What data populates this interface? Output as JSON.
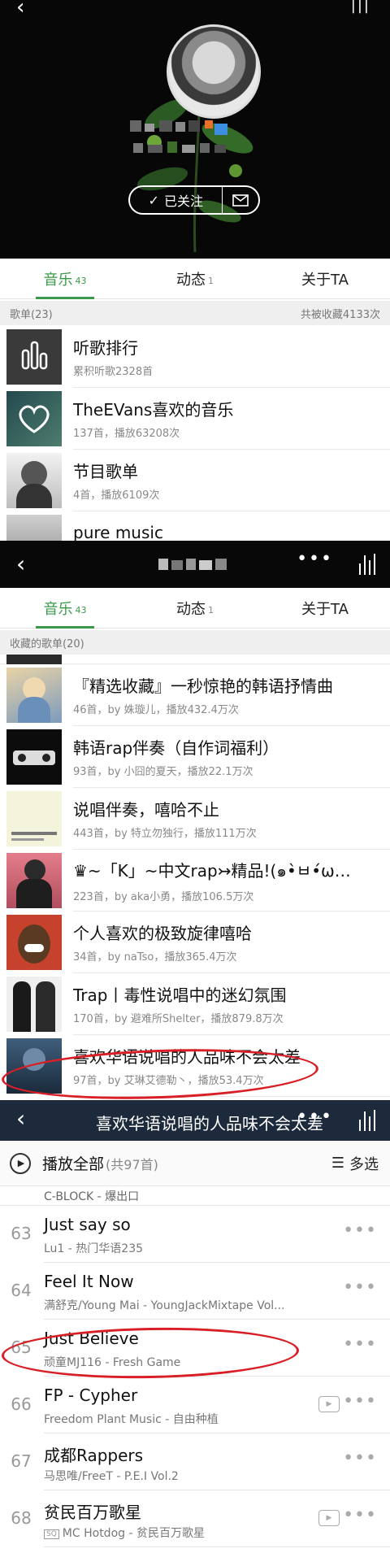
{
  "tabs": [
    {
      "label": "音乐",
      "count": "43"
    },
    {
      "label": "动态",
      "count": "1"
    },
    {
      "label": "关于TA",
      "count": ""
    }
  ],
  "profile": {
    "follow_label": "已关注"
  },
  "playlists_section": {
    "header_left": "歌单(23)",
    "header_right": "共被收藏4133次",
    "items": [
      {
        "title": "听歌排行",
        "sub": "累积听歌2328首"
      },
      {
        "title": "TheEVans喜欢的音乐",
        "sub": "137首，播放63208次"
      },
      {
        "title": "节目歌单",
        "sub": "4首，播放6109次"
      },
      {
        "title": "pure music",
        "sub": ""
      }
    ]
  },
  "collected_section": {
    "header": "收藏的歌单(20)",
    "items": [
      {
        "title": "『精选收藏』一秒惊艳的韩语抒情曲",
        "sub": "46首，by 姝璇儿，播放432.4万次"
      },
      {
        "title": "韩语rap伴奏（自作词福利）",
        "sub": "93首，by 小囧的夏天，播放22.1万次"
      },
      {
        "title": "说唱伴奏，嘻哈不止",
        "sub": "443首，by 特立勿独行，播放111万次"
      },
      {
        "title": "♛~「K」~中文rap↣精品!(๑•̀ㅂ•́ω…",
        "sub": "223首，by aka小勇，播放106.5万次"
      },
      {
        "title": "个人喜欢的极致旋律嘻哈",
        "sub": "34首，by naTso，播放365.4万次"
      },
      {
        "title": "Trap丨毒性说唱中的迷幻氛围",
        "sub": "170首，by 避难所Shelter，播放879.8万次"
      },
      {
        "title": "喜欢华语说唱的人品味不会太差",
        "sub": "97首，by 艾琳艾德勒丶，播放53.4万次"
      }
    ]
  },
  "songlist_section": {
    "title": "喜欢华语说唱的人品味不会太差",
    "play_all": "播放全部",
    "total": "(共97首)",
    "multi_select": "多选",
    "partial_row": "C-BLOCK - 爆出口",
    "songs": [
      {
        "num": "63",
        "name": "Just say so",
        "artist": "Lu1 - 热门华语235",
        "mv": false,
        "sq": false
      },
      {
        "num": "64",
        "name": "Feel It Now",
        "artist": "满舒克/Young Mai - YoungJackMixtape Vol...",
        "mv": false,
        "sq": false
      },
      {
        "num": "65",
        "name": "Just Believe",
        "artist": "顽童MJ116 - Fresh Game",
        "mv": false,
        "sq": false
      },
      {
        "num": "66",
        "name": "FP - Cypher",
        "artist": "Freedom Plant Music - 自由种植",
        "mv": true,
        "sq": false
      },
      {
        "num": "67",
        "name": "成都Rappers",
        "artist": "马思唯/FreeT - P.E.I Vol.2",
        "mv": false,
        "sq": false
      },
      {
        "num": "68",
        "name": "贫民百万歌星",
        "artist": "MC Hotdog - 贫民百万歌星",
        "mv": true,
        "sq": true
      }
    ]
  },
  "colors": {
    "accent": "#3b9a49",
    "highlight": "#d81f26",
    "song_header": "#1d2a3b"
  }
}
